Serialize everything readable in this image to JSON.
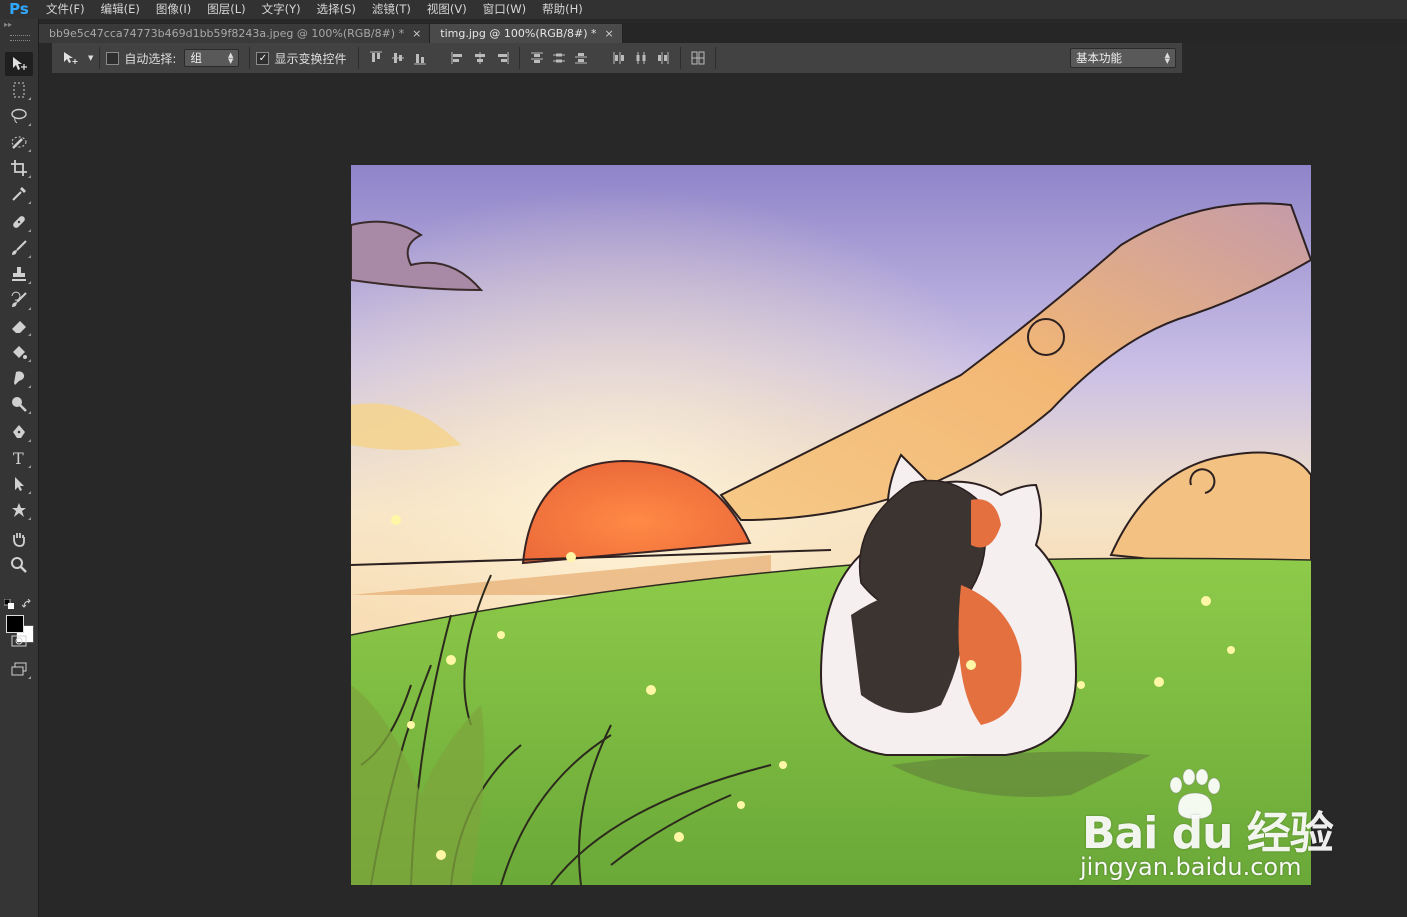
{
  "app": {
    "logo_text": "Ps"
  },
  "menu": {
    "items": [
      "文件(F)",
      "编辑(E)",
      "图像(I)",
      "图层(L)",
      "文字(Y)",
      "选择(S)",
      "滤镜(T)",
      "视图(V)",
      "窗口(W)",
      "帮助(H)"
    ]
  },
  "tabs": [
    {
      "label": "bb9e5c47cca74773b469d1bb59f8243a.jpeg @ 100%(RGB/8#) *",
      "active": false
    },
    {
      "label": "timg.jpg @ 100%(RGB/8#) *",
      "active": true
    }
  ],
  "options": {
    "auto_select_label": "自动选择:",
    "auto_select_checked": false,
    "auto_select_target": "组",
    "show_transform_label": "显示变换控件",
    "show_transform_checked": true,
    "workspace_preset": "基本功能"
  },
  "tools": [
    "move-tool-icon",
    "marquee-tool-icon",
    "lasso-tool-icon",
    "quick-select-tool-icon",
    "crop-tool-icon",
    "eyedropper-tool-icon",
    "healing-brush-tool-icon",
    "brush-tool-icon",
    "clone-stamp-tool-icon",
    "history-brush-tool-icon",
    "eraser-tool-icon",
    "paint-bucket-tool-icon",
    "smudge-tool-icon",
    "dodge-tool-icon",
    "pen-tool-icon",
    "type-tool-icon",
    "path-select-tool-icon",
    "custom-shape-tool-icon",
    "hand-tool-icon",
    "zoom-tool-icon"
  ],
  "colors": {
    "foreground": "#000000",
    "background": "#ffffff",
    "accent": "#31a8ff"
  },
  "watermark": {
    "brand": "Bai du 经验",
    "url": "jingyan.baidu.com"
  }
}
